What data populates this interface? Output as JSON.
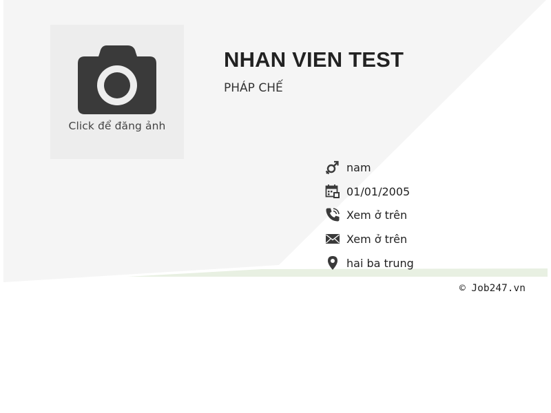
{
  "colors": {
    "background": "#ffffff",
    "panel": "#f5f5f5",
    "accent_strip": "#e8f0e2",
    "photo_box": "#ededed",
    "icon": "#3a3a3a",
    "text_dark": "#222222"
  },
  "photo": {
    "icon": "camera-icon",
    "caption": "Click để đăng ảnh"
  },
  "profile": {
    "name": "NHAN VIEN TEST",
    "job_title": "PHÁP CHẾ"
  },
  "info": [
    {
      "icon": "gender-icon",
      "value": "nam"
    },
    {
      "icon": "calendar-icon",
      "value": "01/01/2005"
    },
    {
      "icon": "phone-icon",
      "value": "Xem ở trên"
    },
    {
      "icon": "envelope-icon",
      "value": "Xem ở trên"
    },
    {
      "icon": "map-pin-icon",
      "value": "hai ba trung"
    }
  ],
  "footer": {
    "copyright": "© Job247.vn"
  }
}
